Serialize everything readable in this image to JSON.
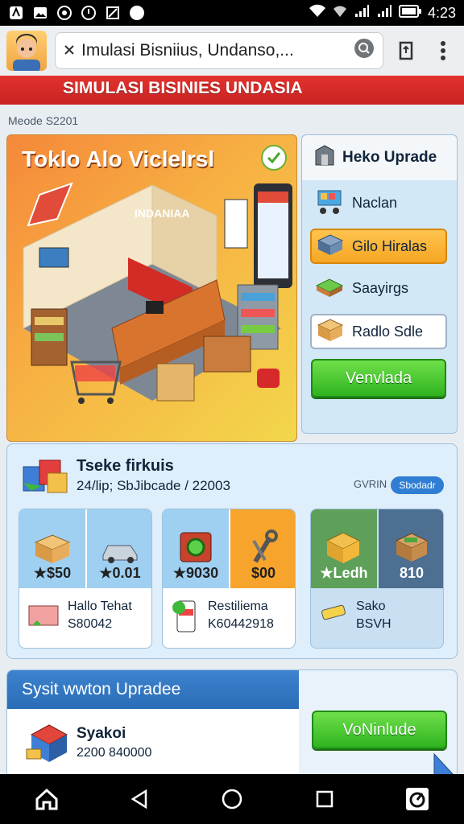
{
  "status_bar": {
    "time": "4:23"
  },
  "browser": {
    "url": "Imulasi Bisniius, Undanso,..."
  },
  "banner": {
    "title": "SIMULASI BISINIES UNDASIA"
  },
  "mode_label": "Meode S2201",
  "hero": {
    "title": "Toklo Alo Viclelrsl",
    "sign_text": "INDANIAA"
  },
  "right_panel": {
    "header": "Heko Uprade",
    "items": [
      {
        "label": "Naclan",
        "style": "plain",
        "icon": "cart-icon"
      },
      {
        "label": "Gilo Hiralas",
        "style": "orange",
        "icon": "box-icon"
      },
      {
        "label": "Saayirgs",
        "style": "plain",
        "icon": "cash-icon"
      },
      {
        "label": "Radlo Sdle",
        "style": "white",
        "icon": "package-icon"
      }
    ],
    "button": "Venvlada"
  },
  "section2": {
    "title": "Tseke firkuis",
    "subtitle": "24/lip; SbJibcade / 22003",
    "link": "GVRIN",
    "pill": "Sbodadr",
    "cards": [
      {
        "tiles": [
          {
            "value": "★$50",
            "icon": "box-icon",
            "color": "#9fd0f2"
          },
          {
            "value": "★0.01",
            "icon": "car-icon",
            "color": "#9fd0f2"
          }
        ],
        "name": "Hallo Tehat",
        "amount": "S80042",
        "icon": "gift-icon"
      },
      {
        "tiles": [
          {
            "value": "★9030",
            "icon": "machine-icon",
            "color": "#9fd0f2"
          },
          {
            "value": "$00",
            "icon": "tools-icon",
            "color": "#f7a42c"
          }
        ],
        "name": "Restiliema",
        "amount": "K60442918",
        "icon": "phone-icon"
      },
      {
        "tiles": [
          {
            "value": "★Ledh",
            "icon": "crate-icon",
            "color": "#5e9f5a"
          },
          {
            "value": "810",
            "icon": "crate-icon",
            "color": "#4c6f92"
          }
        ],
        "name": "Sako",
        "amount": "BSVH",
        "icon": "bar-icon"
      }
    ]
  },
  "section3": {
    "title": "Sysit wwton Upradee",
    "item_name": "Syakoi",
    "item_value": "2200 840000",
    "button": "VoNinlude"
  },
  "colors": {
    "accent_red": "#d42a28",
    "accent_green": "#34b825",
    "accent_blue": "#2f7ed3"
  }
}
